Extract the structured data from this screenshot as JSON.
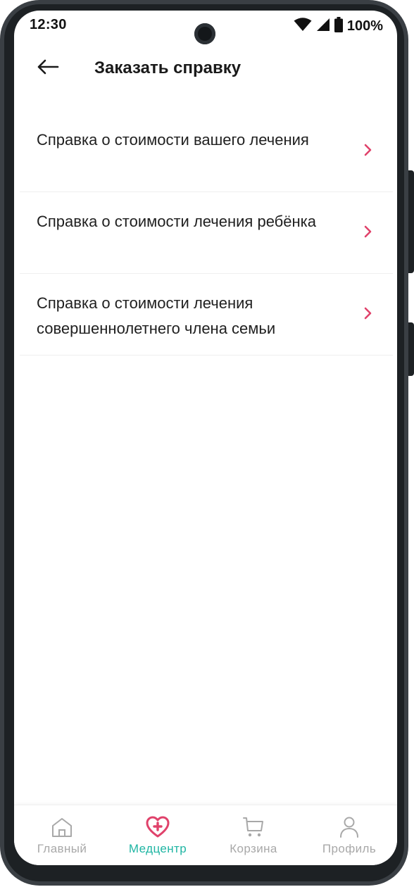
{
  "status_bar": {
    "time": "12:30",
    "battery_text": "100%"
  },
  "header": {
    "title": "Заказать справку",
    "back_icon": "arrow-left-icon"
  },
  "list": {
    "items": [
      {
        "label": "Справка о стоимости вашего лечения",
        "icon": "chevron-right-icon"
      },
      {
        "label": "Справка о стоимости лечения ребёнка",
        "icon": "chevron-right-icon"
      },
      {
        "label": "Справка о стоимости лечения совершеннолетнего члена семьи",
        "icon": "chevron-right-icon"
      }
    ]
  },
  "bottom_nav": {
    "items": [
      {
        "label": "Главный",
        "icon": "home-icon",
        "active": false
      },
      {
        "label": "Медцентр",
        "icon": "heart-plus-icon",
        "active": true
      },
      {
        "label": "Корзина",
        "icon": "cart-icon",
        "active": false
      },
      {
        "label": "Профиль",
        "icon": "person-icon",
        "active": false
      }
    ]
  },
  "colors": {
    "accent_pink": "#e0426b",
    "accent_teal": "#1fb5a3",
    "inactive_gray": "#a8a8a8",
    "text_dark": "#1f1f1f"
  }
}
